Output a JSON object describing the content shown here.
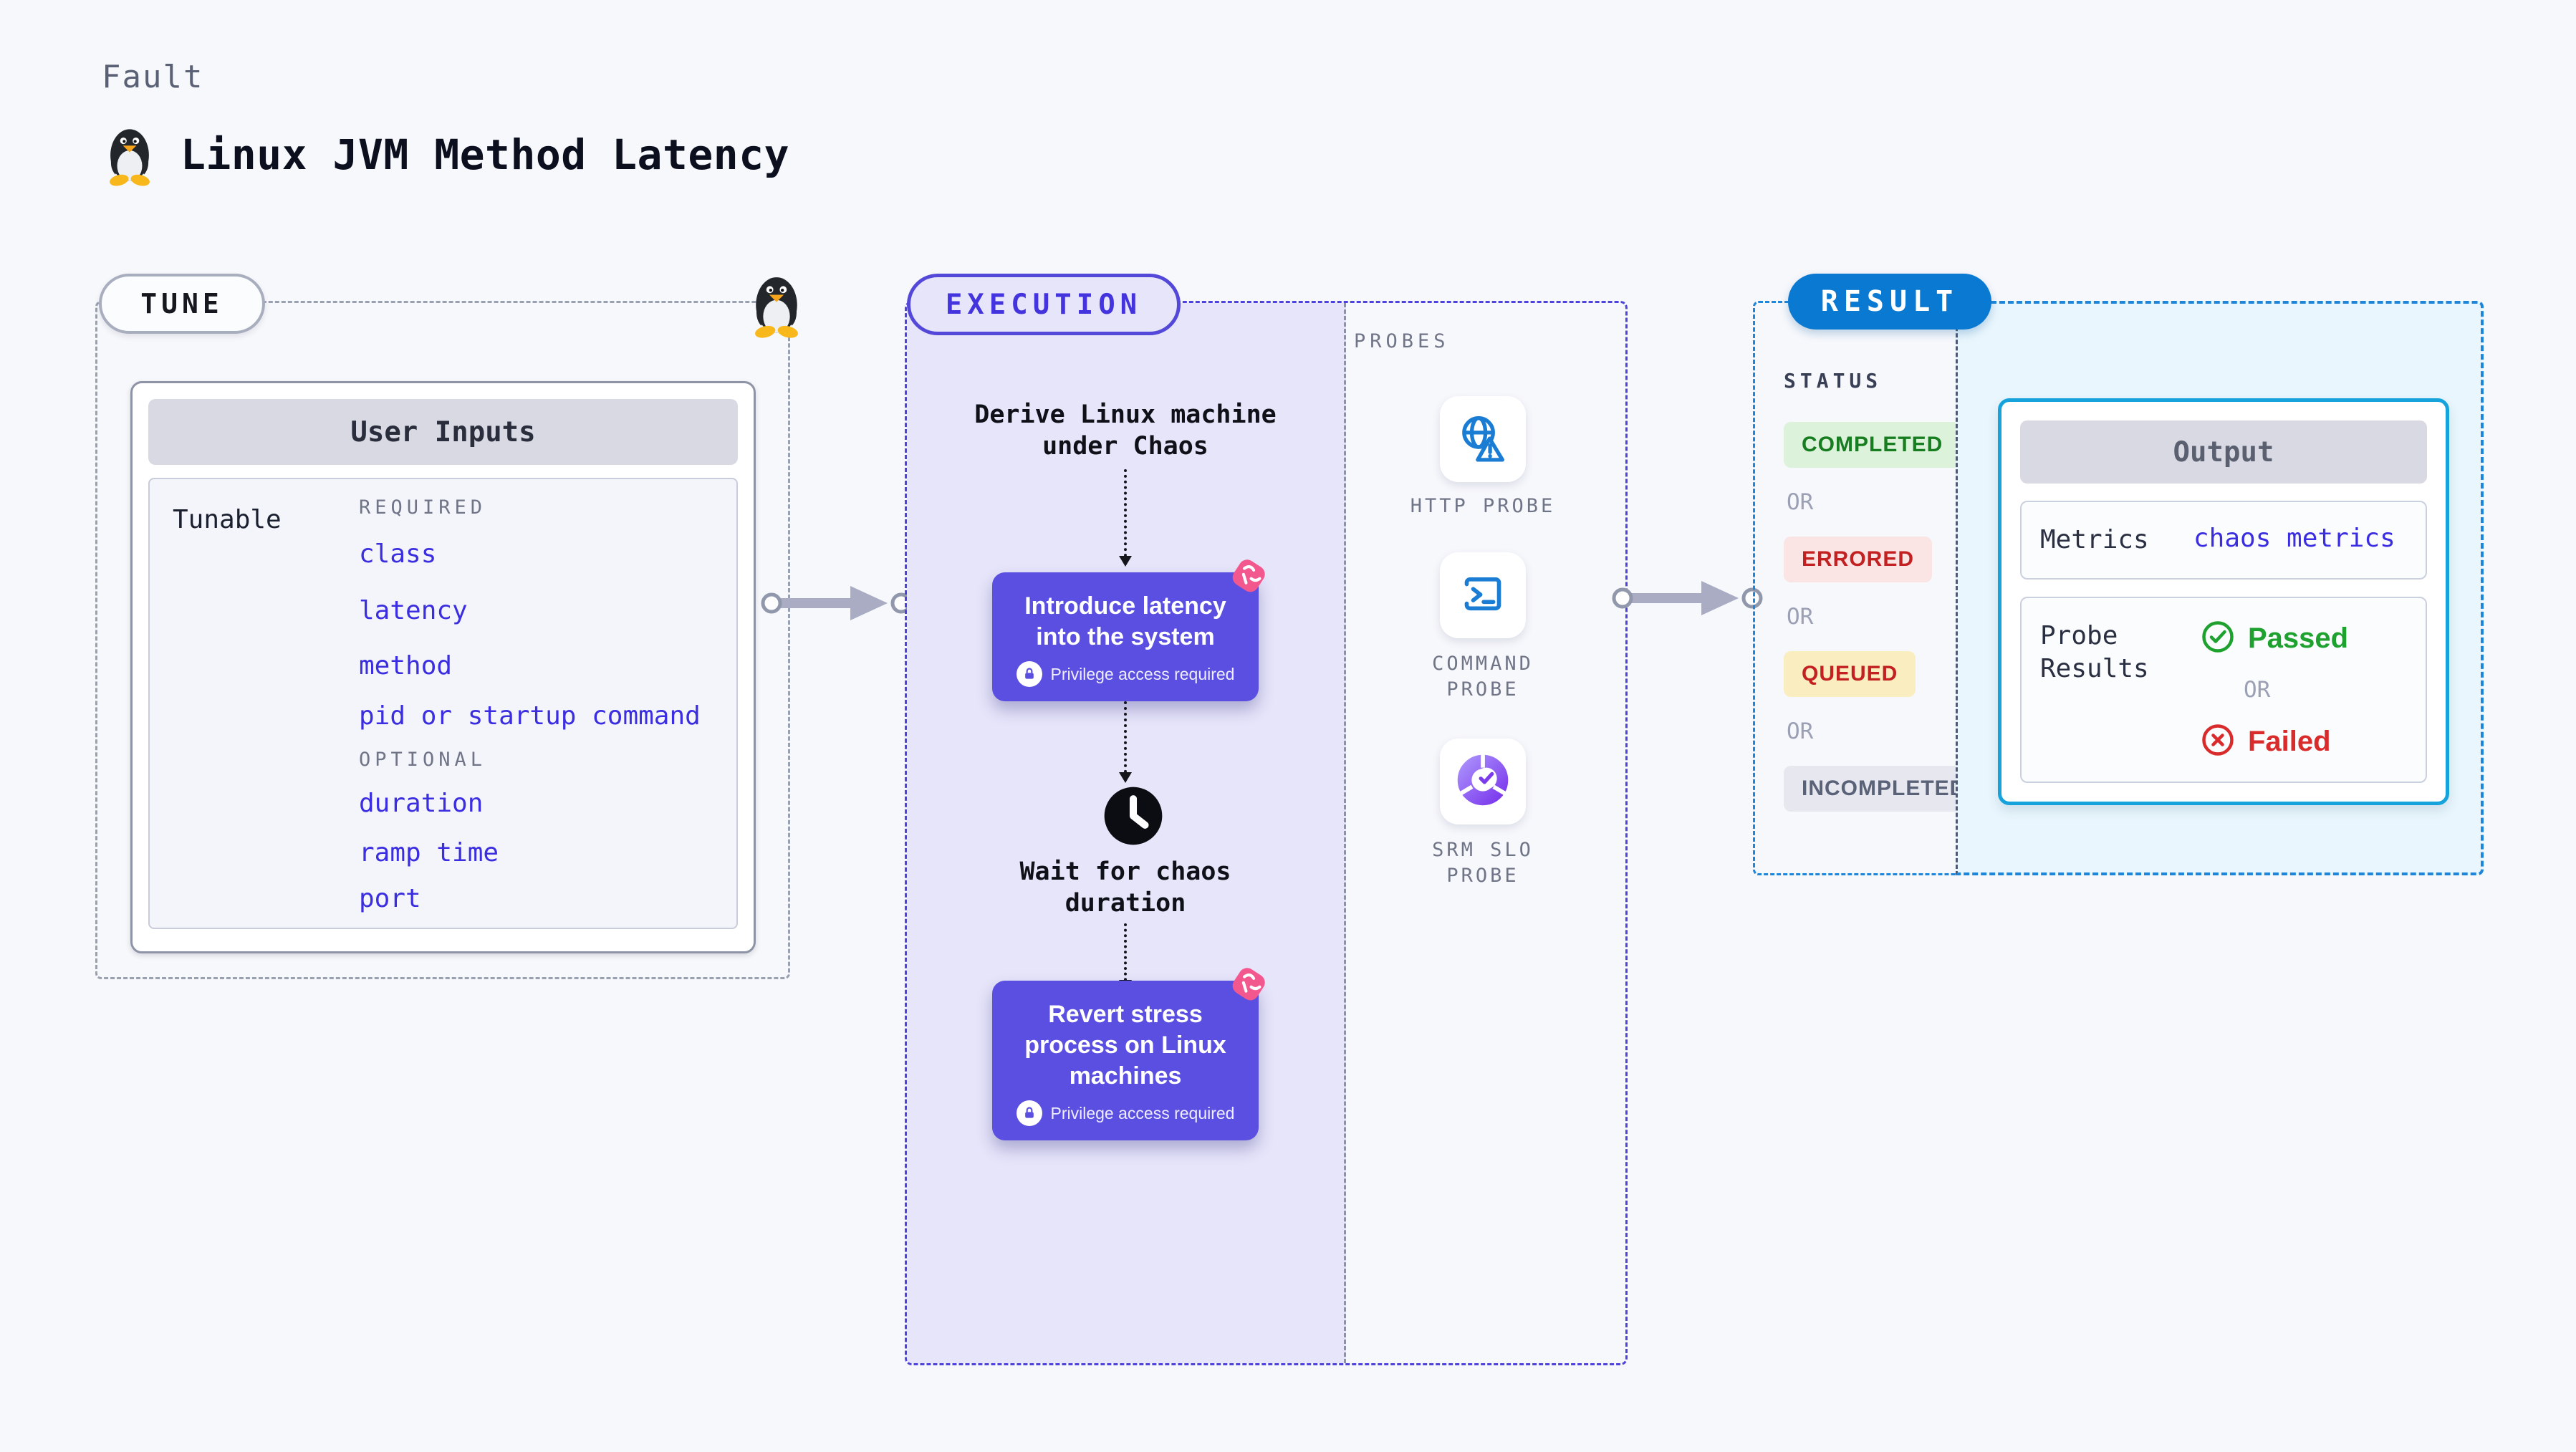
{
  "page": {
    "kicker": "Fault",
    "title": "Linux JVM Method Latency"
  },
  "tune": {
    "pill": "TUNE",
    "user_inputs": {
      "title": "User Inputs",
      "row_label": "Tunable",
      "required_label": "REQUIRED",
      "required_items": [
        "class",
        "latency",
        "method",
        "pid or startup command"
      ],
      "optional_label": "OPTIONAL",
      "optional_items": [
        "duration",
        "ramp time",
        "port"
      ]
    }
  },
  "execution": {
    "pill": "EXECUTION",
    "derive_step": "Derive Linux machine under Chaos",
    "introduce_step": "Introduce latency into the system",
    "wait_step": "Wait for chaos duration",
    "revert_step": "Revert stress process on Linux machines",
    "privilege_note": "Privilege access required"
  },
  "probes": {
    "label": "PROBES",
    "items": [
      {
        "name": "HTTP PROBE",
        "icon": "globe-alert-icon"
      },
      {
        "name": "COMMAND PROBE",
        "icon": "terminal-icon"
      },
      {
        "name": "SRM SLO PROBE",
        "icon": "slo-donut-icon"
      }
    ]
  },
  "result": {
    "pill": "RESULT",
    "status": {
      "title": "STATUS",
      "or_label": "OR",
      "badges": [
        {
          "label": "COMPLETED",
          "bg": "#DDF2DB",
          "fg": "#177D20"
        },
        {
          "label": "ERRORED",
          "bg": "#FBE4E4",
          "fg": "#C32121"
        },
        {
          "label": "QUEUED",
          "bg": "#FAEDBF",
          "fg": "#C32121"
        },
        {
          "label": "INCOMPLETED",
          "bg": "#E7E7EF",
          "fg": "#5A6278"
        }
      ]
    },
    "output": {
      "title": "Output",
      "metrics_label": "Metrics",
      "metrics_value": "chaos metrics",
      "probe_results_label": "Probe Results",
      "passed_label": "Passed",
      "failed_label": "Failed",
      "or_label": "OR"
    }
  },
  "colors": {
    "accent_indigo": "#5348D8",
    "node_purple": "#5A4FE0",
    "accent_blue": "#0A79D2",
    "accent_pink": "#F2578E",
    "passed_green": "#1FA12F",
    "failed_red": "#D92B2B",
    "link_blue": "#3B2EE0"
  }
}
